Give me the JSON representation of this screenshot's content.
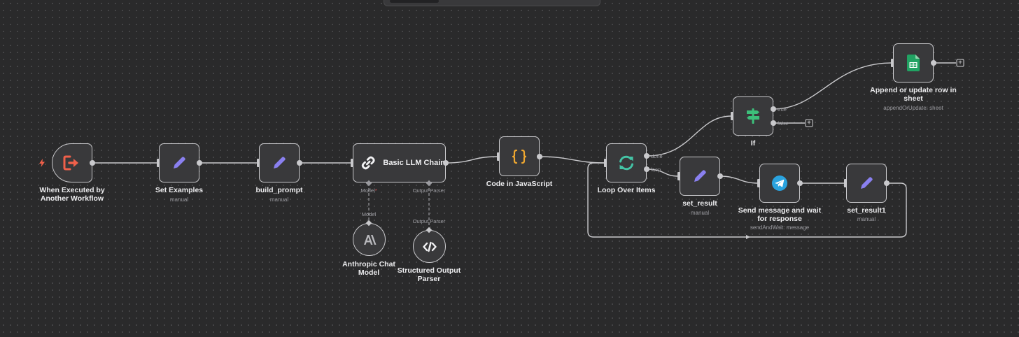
{
  "nodes": {
    "trigger": {
      "title_line1": "When Executed by",
      "title_line2": "Another Workflow"
    },
    "set_examples": {
      "title": "Set Examples",
      "subtitle": "manual"
    },
    "build_prompt": {
      "title": "build_prompt",
      "subtitle": "manual"
    },
    "llm_chain": {
      "title": "Basic LLM Chain",
      "model_port": "Model",
      "parser_port": "Output Parser"
    },
    "anthropic": {
      "title_line1": "Anthropic Chat",
      "title_line2": "Model",
      "connector": "Model"
    },
    "parser": {
      "title_line1": "Structured Output",
      "title_line2": "Parser",
      "connector": "Output Parser"
    },
    "code": {
      "title": "Code in JavaScript"
    },
    "loop": {
      "title": "Loop Over Items",
      "done_label": "done",
      "loop_label": "loop"
    },
    "if_node": {
      "title": "If",
      "true_label": "true",
      "false_label": "false"
    },
    "sheets": {
      "title_line1": "Append or update row in",
      "title_line2": "sheet",
      "subtitle": "appendOrUpdate: sheet"
    },
    "set_result": {
      "title": "set_result",
      "subtitle": "manual"
    },
    "telegram": {
      "title_line1": "Send message and wait",
      "title_line2": "for response",
      "subtitle": "sendAndWait: message"
    },
    "set_result1": {
      "title": "set_result1",
      "subtitle": "manual"
    }
  },
  "colors": {
    "trigger_icon": "#f0604a",
    "edit_icon": "#8a80f0",
    "code_icon": "#f0a830",
    "loop_icon": "#44c4a6",
    "if_icon": "#3dbf7a",
    "sheets_icon": "#21a363",
    "telegram_icon": "#2aa3df",
    "wire": "#c9c9cc"
  },
  "icons": {
    "trigger": "sign-out-icon",
    "set": "pencil-icon",
    "chain": "link-icon",
    "anthropic": "anthropic-logo-icon",
    "parser": "code-icon",
    "code": "curly-braces-icon",
    "loop": "sync-icon",
    "if": "signpost-icon",
    "sheets": "google-sheets-icon",
    "telegram": "telegram-icon"
  }
}
